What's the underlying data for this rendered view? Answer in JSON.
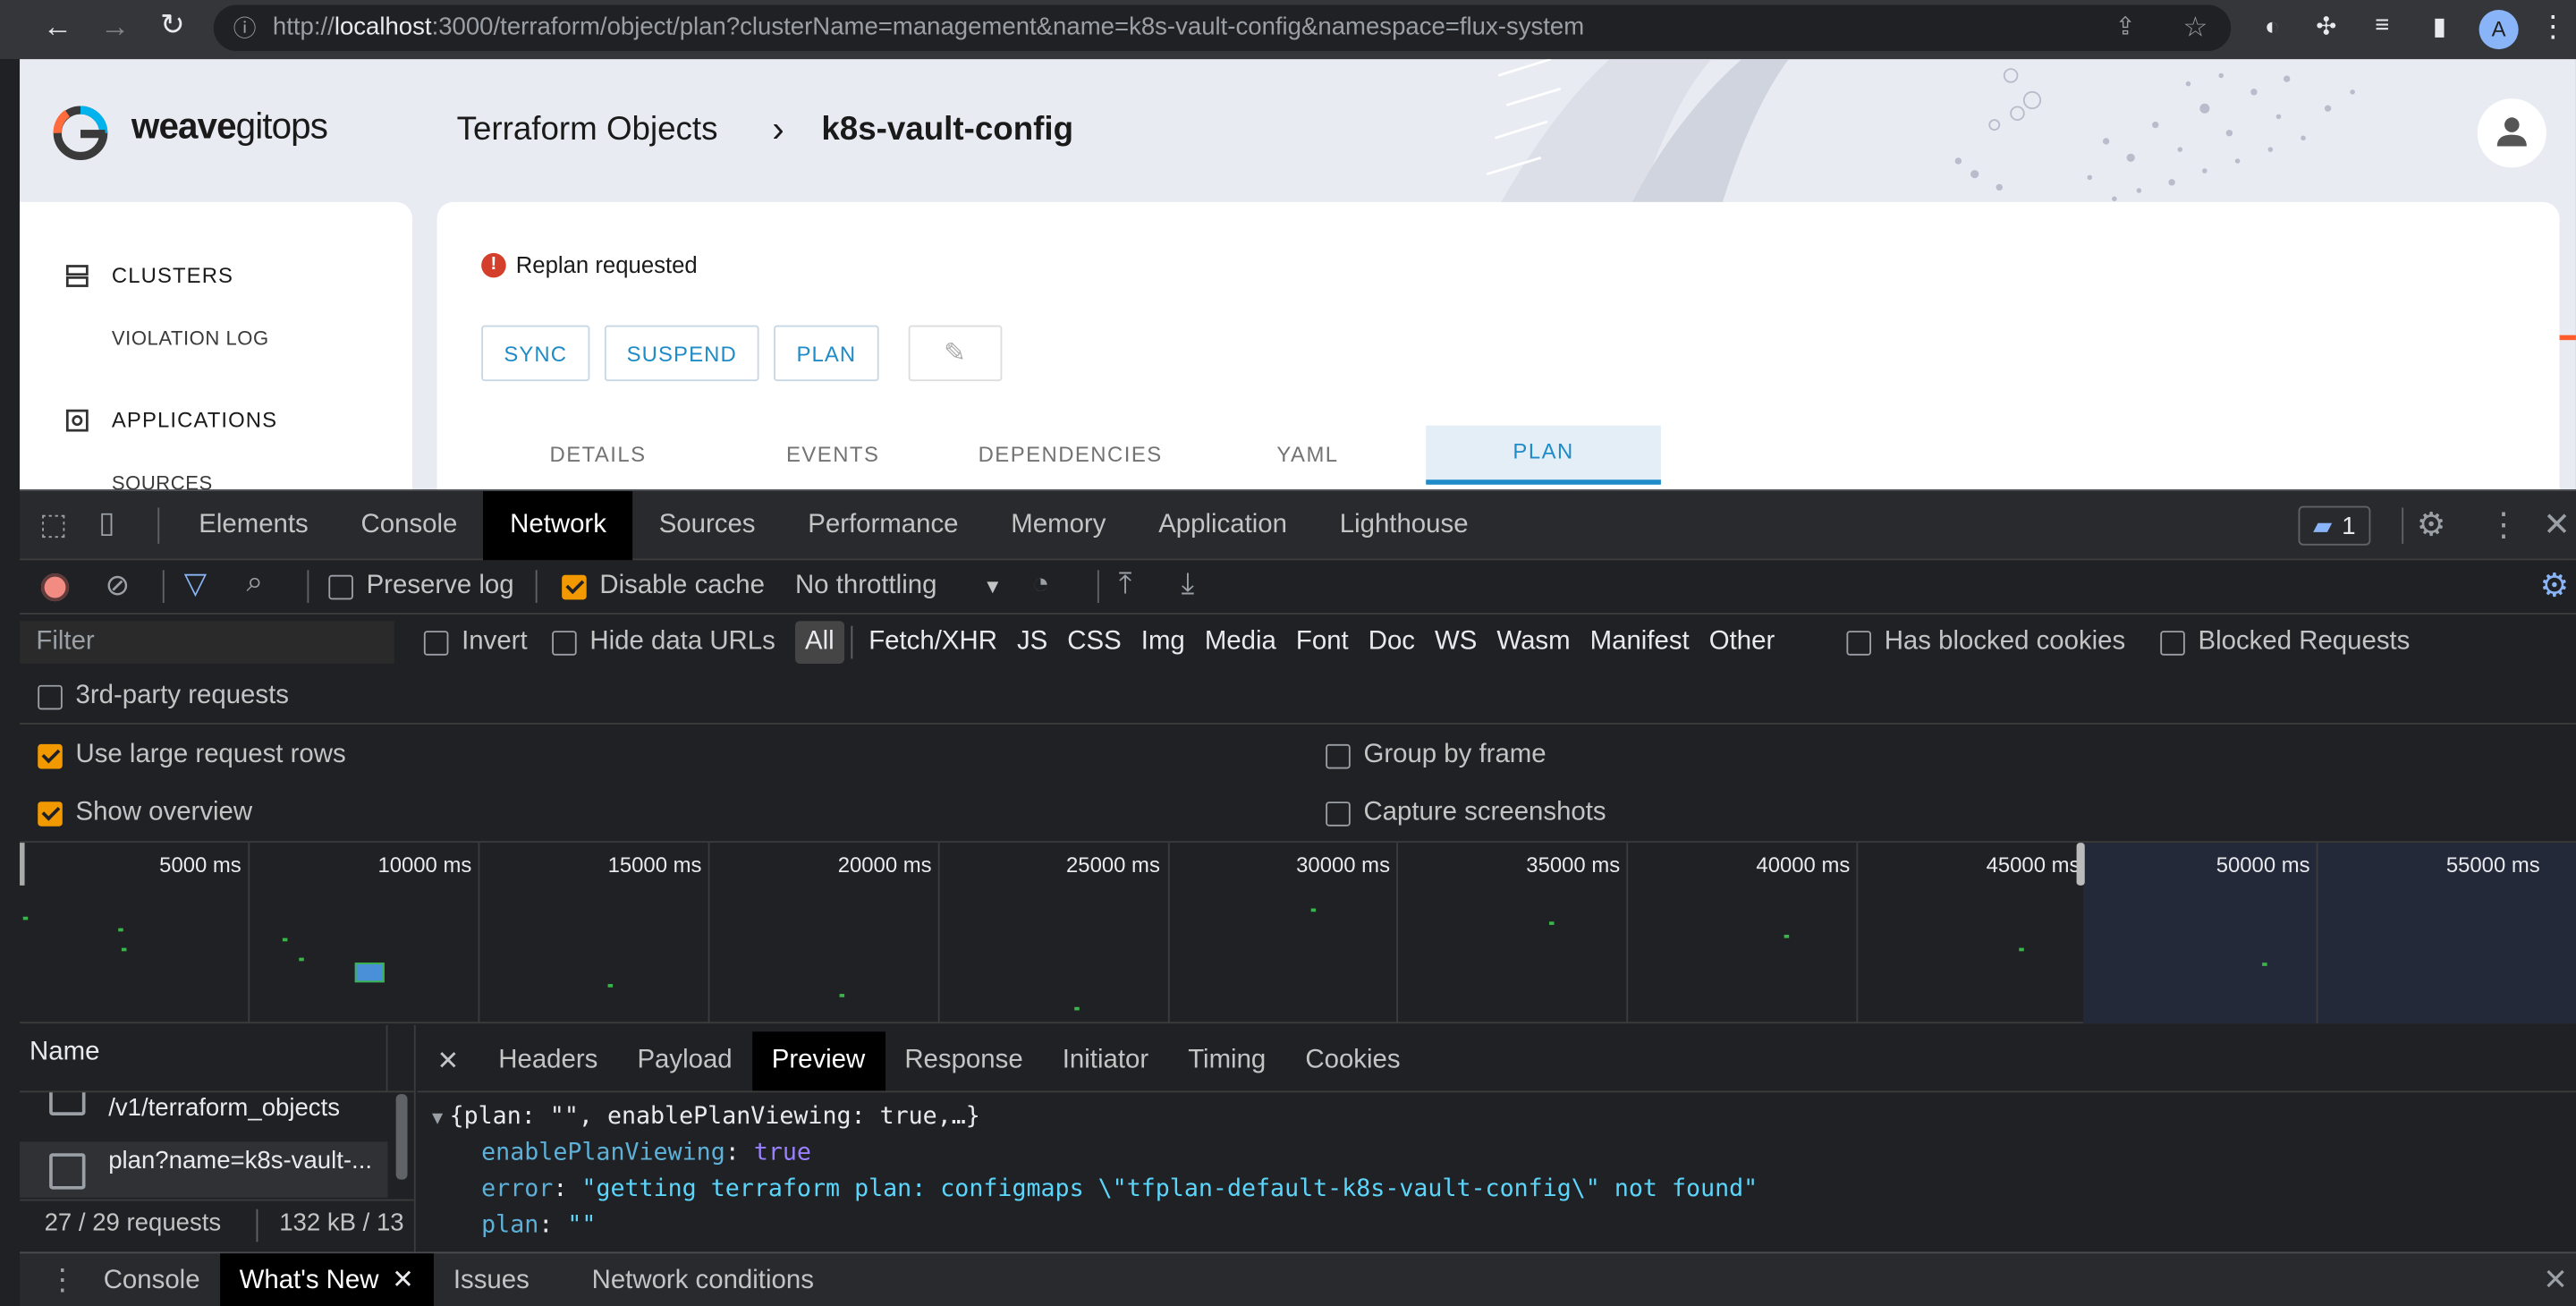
{
  "browser": {
    "url_prefix": "http://",
    "url_host": "localhost",
    "url_rest": ":3000/terraform/object/plan?clusterName=management&name=k8s-vault-config&namespace=flux-system",
    "profile_initial": "A"
  },
  "app": {
    "logo_bold": "weave",
    "logo_rest": "gitops",
    "breadcrumb_parent": "Terraform Objects",
    "breadcrumb_sep": "›",
    "breadcrumb_current": "k8s-vault-config",
    "nav": {
      "clusters": "CLUSTERS",
      "violation_log": "VIOLATION LOG",
      "applications": "APPLICATIONS",
      "sources": "SOURCES"
    },
    "alert_text": "Replan requested",
    "actions": {
      "sync": "SYNC",
      "suspend": "SUSPEND",
      "plan": "PLAN"
    },
    "tabs": [
      {
        "label": "DETAILS"
      },
      {
        "label": "EVENTS"
      },
      {
        "label": "DEPENDENCIES"
      },
      {
        "label": "YAML"
      },
      {
        "label": "PLAN"
      }
    ],
    "active_tab": "PLAN",
    "accent_color": "#1f8bc7",
    "error_color": "#d33f2a"
  },
  "devtools": {
    "panels": [
      "Elements",
      "Console",
      "Network",
      "Sources",
      "Performance",
      "Memory",
      "Application",
      "Lighthouse"
    ],
    "active_panel": "Network",
    "issues_count": "1",
    "toolbar": {
      "preserve_log": "Preserve log",
      "disable_cache": "Disable cache",
      "throttling": "No throttling"
    },
    "filter": {
      "placeholder": "Filter",
      "invert": "Invert",
      "hide_data_urls": "Hide data URLs",
      "types": [
        "All",
        "Fetch/XHR",
        "JS",
        "CSS",
        "Img",
        "Media",
        "Font",
        "Doc",
        "WS",
        "Wasm",
        "Manifest",
        "Other"
      ],
      "has_blocked_cookies": "Has blocked cookies",
      "blocked_requests": "Blocked Requests",
      "third_party": "3rd-party requests"
    },
    "settings": {
      "large_rows": "Use large request rows",
      "show_overview": "Show overview",
      "group_by_frame": "Group by frame",
      "capture_screenshots": "Capture screenshots"
    },
    "timeline_ticks": [
      "5000 ms",
      "10000 ms",
      "15000 ms",
      "20000 ms",
      "25000 ms",
      "30000 ms",
      "35000 ms",
      "40000 ms",
      "45000 ms",
      "50000 ms",
      "55000 ms"
    ],
    "requests": {
      "name_header": "Name",
      "rows": [
        "/v1/terraform_objects",
        "plan?name=k8s-vault-..."
      ],
      "summary": "27 / 29 requests",
      "transferred": "132 kB / 13"
    },
    "detail_tabs": [
      "Headers",
      "Payload",
      "Preview",
      "Response",
      "Initiator",
      "Timing",
      "Cookies"
    ],
    "active_detail_tab": "Preview",
    "preview": {
      "summary": "{plan: \"\", enablePlanViewing: true,…}",
      "enable_key": "enablePlanViewing",
      "enable_val": "true",
      "error_key": "error",
      "error_val": "\"getting terraform plan: configmaps \\\"tfplan-default-k8s-vault-config\\\" not found\"",
      "plan_key": "plan",
      "plan_val": "\"\""
    },
    "drawer_tabs": [
      "Console",
      "What's New",
      "Issues",
      "Network conditions"
    ],
    "active_drawer_tab": "What's New"
  }
}
